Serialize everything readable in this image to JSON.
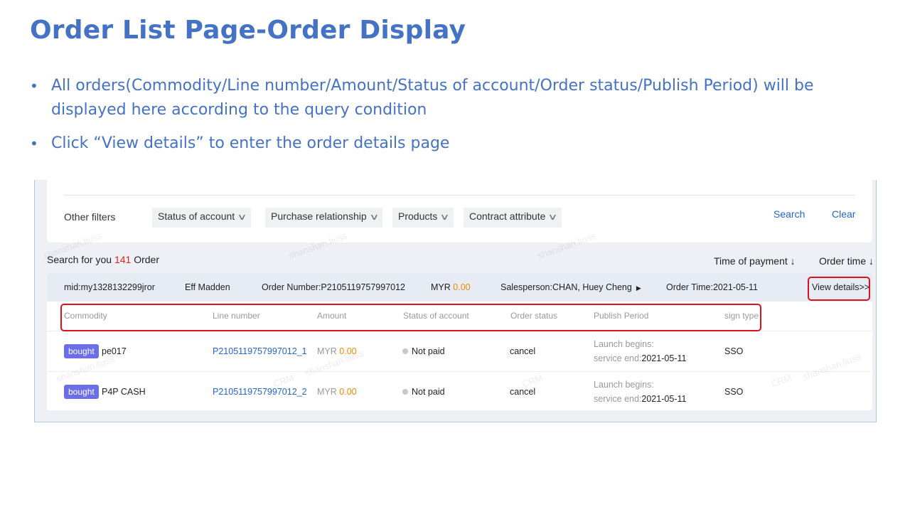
{
  "slide": {
    "title": "Order List Page-Order Display",
    "bullets": [
      "All orders(Commodity/Line number/Amount/Status of account/Order status/Publish Period) will be displayed here according to the query condition",
      "Click “View details” to enter the order details page"
    ]
  },
  "colors": {
    "title": "#4472c4",
    "link": "#2266cc",
    "amount": "#f08a00",
    "badge": "#6c6ee8",
    "highlight": "#d9121b"
  },
  "filters": {
    "label": "Other filters",
    "dropdowns": [
      "Status of account",
      "Purchase relationship",
      "Products",
      "Contract attribute"
    ],
    "search_label": "Search",
    "clear_label": "Clear"
  },
  "results": {
    "prefix": "Search for you",
    "count": "141",
    "suffix": "Order",
    "sort_payment": "Time of payment ↓",
    "sort_order": "Order time ↓"
  },
  "order": {
    "mid": "mid:my1328132299jror",
    "customer": "Eff Madden",
    "order_number": "Order Number:P2105119757997012",
    "currency": "MYR",
    "amount": "0.00",
    "salesperson": "Salesperson:CHAN, Huey Cheng",
    "order_time": "Order Time:2021-05-11",
    "view_details": "View details>>",
    "columns": [
      "Commodity",
      "Line number",
      "Amount",
      "Status of account",
      "Order status",
      "Publish Period",
      "sign type"
    ],
    "lines": [
      {
        "badge": "bought",
        "commodity": "pe017",
        "line_number": "P2105119757997012_1",
        "currency": "MYR",
        "amount": "0.00",
        "account_status": "Not paid",
        "order_status": "cancel",
        "launch": "Launch begins:",
        "service_end_label": "service end:",
        "service_end": "2021-05-11",
        "sign_type": "SSO"
      },
      {
        "badge": "bought",
        "commodity": "P4P CASH",
        "line_number": "P2105119757997012_2",
        "currency": "MYR",
        "amount": "0.00",
        "account_status": "Not paid",
        "order_status": "cancel",
        "launch": "Launch begins:",
        "service_end_label": "service end:",
        "service_end": "2021-05-11",
        "sign_type": "SSO"
      }
    ]
  },
  "watermarks": [
    "shanshan.liuss",
    "shanshan.liuss",
    "shanshan.liuss",
    "CRM",
    "CRM",
    "CRM",
    "shanshan.liuss",
    "shanshan.liuss",
    "shanshan.liuss"
  ]
}
